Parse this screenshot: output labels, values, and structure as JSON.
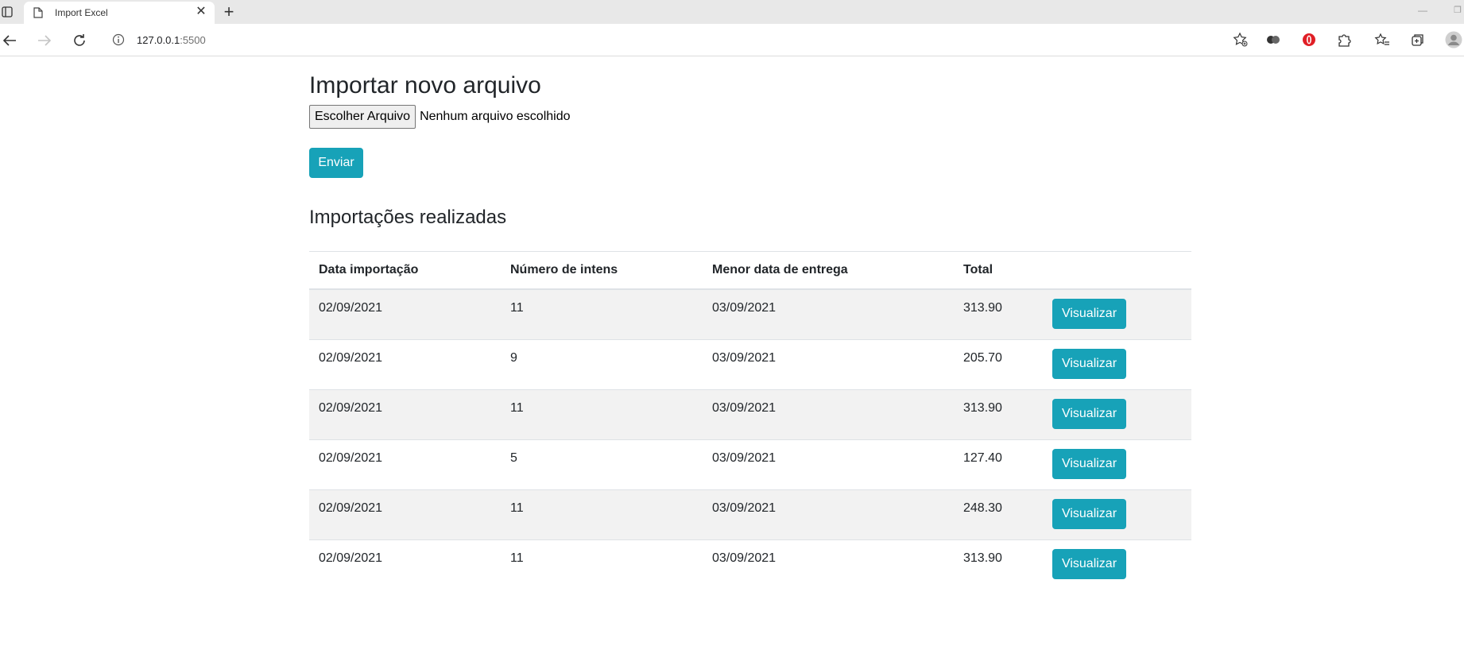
{
  "browser": {
    "tab_title": "Import Excel",
    "url_host": "127.0.0.1",
    "url_port": ":5500"
  },
  "page": {
    "title": "Importar novo arquivo",
    "file_button_label": "Escolher Arquivo",
    "file_status": "Nenhum arquivo escolhido",
    "send_label": "Enviar",
    "section_title": "Importações realizadas"
  },
  "table": {
    "headers": [
      "Data importação",
      "Número de intens",
      "Menor data de entrega",
      "Total",
      ""
    ],
    "action_label": "Visualizar",
    "rows": [
      {
        "data": "02/09/2021",
        "itens": "11",
        "menor": "03/09/2021",
        "total": "313.90"
      },
      {
        "data": "02/09/2021",
        "itens": "9",
        "menor": "03/09/2021",
        "total": "205.70"
      },
      {
        "data": "02/09/2021",
        "itens": "11",
        "menor": "03/09/2021",
        "total": "313.90"
      },
      {
        "data": "02/09/2021",
        "itens": "5",
        "menor": "03/09/2021",
        "total": "127.40"
      },
      {
        "data": "02/09/2021",
        "itens": "11",
        "menor": "03/09/2021",
        "total": "248.30"
      },
      {
        "data": "02/09/2021",
        "itens": "11",
        "menor": "03/09/2021",
        "total": "313.90"
      }
    ]
  },
  "colors": {
    "accent": "#17a2b8",
    "stripe": "#f2f2f2"
  }
}
